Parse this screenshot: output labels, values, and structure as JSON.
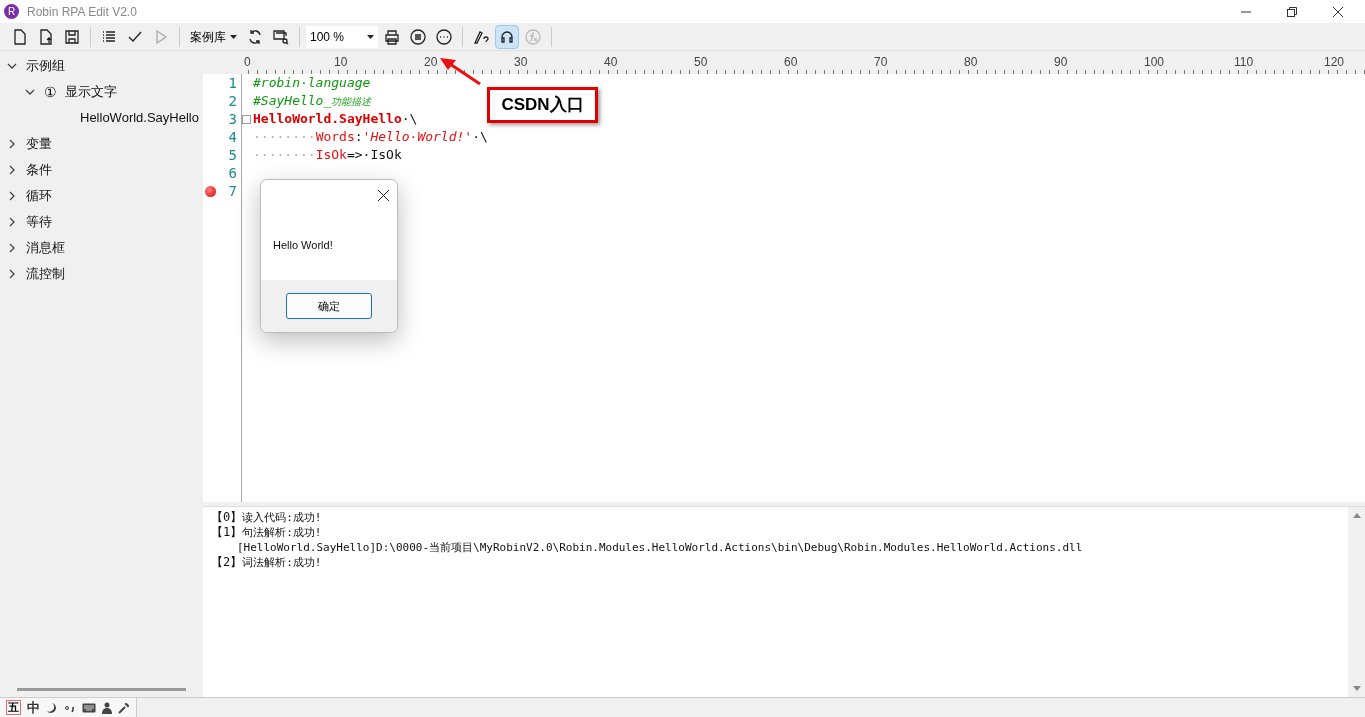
{
  "window": {
    "title": "Robin RPA Edit V2.0",
    "logo": "R"
  },
  "toolbar": {
    "library": "案例库",
    "zoom": "100 %",
    "qq_selected": true
  },
  "sidebar": {
    "items": [
      {
        "label": "示例组",
        "expanded": true,
        "children": [
          {
            "label": "显示文字",
            "badge": "①",
            "expanded": true,
            "children": [
              {
                "label": "HelloWorld.SayHello"
              }
            ]
          }
        ]
      },
      {
        "label": "变量",
        "expanded": false
      },
      {
        "label": "条件",
        "expanded": false
      },
      {
        "label": "循环",
        "expanded": false
      },
      {
        "label": "等待",
        "expanded": false
      },
      {
        "label": "消息框",
        "expanded": false
      },
      {
        "label": "流控制",
        "expanded": false
      }
    ]
  },
  "ruler": [
    "0",
    "10",
    "20",
    "30",
    "40",
    "50",
    "60",
    "70",
    "80",
    "90",
    "100",
    "110",
    "120"
  ],
  "editor": {
    "lines": [
      {
        "number": "1",
        "breakpoint": false,
        "fold": false,
        "segments": [
          {
            "kind": "comment",
            "text": "#robin·language"
          }
        ]
      },
      {
        "number": "2",
        "breakpoint": false,
        "fold": false,
        "segments": [
          {
            "kind": "comment",
            "text": "#SayHello_"
          },
          {
            "kind": "note",
            "text": "功能描述"
          }
        ]
      },
      {
        "number": "3",
        "breakpoint": false,
        "fold": true,
        "segments": [
          {
            "kind": "keyword",
            "text": "HelloWorld.SayHello"
          },
          {
            "kind": "plain",
            "text": "·\\"
          }
        ]
      },
      {
        "number": "4",
        "breakpoint": false,
        "fold": false,
        "segments": [
          {
            "kind": "space",
            "text": "········"
          },
          {
            "kind": "param",
            "text": "Words"
          },
          {
            "kind": "plain",
            "text": ":"
          },
          {
            "kind": "string",
            "text": "'Hello·World!'"
          },
          {
            "kind": "plain",
            "text": "·\\"
          }
        ]
      },
      {
        "number": "5",
        "breakpoint": false,
        "fold": false,
        "segments": [
          {
            "kind": "space",
            "text": "········"
          },
          {
            "kind": "param",
            "text": "IsOk"
          },
          {
            "kind": "plain",
            "text": "=>·IsOk"
          }
        ]
      },
      {
        "number": "6",
        "breakpoint": false,
        "fold": false
      },
      {
        "number": "7",
        "breakpoint": true,
        "fold": false
      }
    ]
  },
  "dialog": {
    "message": "Hello World!",
    "button": "确定"
  },
  "annotation": {
    "label": "CSDN入口"
  },
  "output": {
    "lines": [
      {
        "tag": "【0】",
        "text": "读入代码:成功!"
      },
      {
        "tag": "【1】",
        "text": "句法解析:成功!"
      },
      {
        "text": "[HelloWorld.SayHello]D:\\0000-当前项目\\MyRobinV2.0\\Robin.Modules.HelloWorld.Actions\\bin\\Debug\\Robin.Modules.HelloWorld.Actions.dll"
      },
      {
        "tag": "【2】",
        "text": "词法解析:成功!"
      }
    ]
  },
  "taskbar": {
    "ime": [
      "五",
      "中"
    ]
  }
}
